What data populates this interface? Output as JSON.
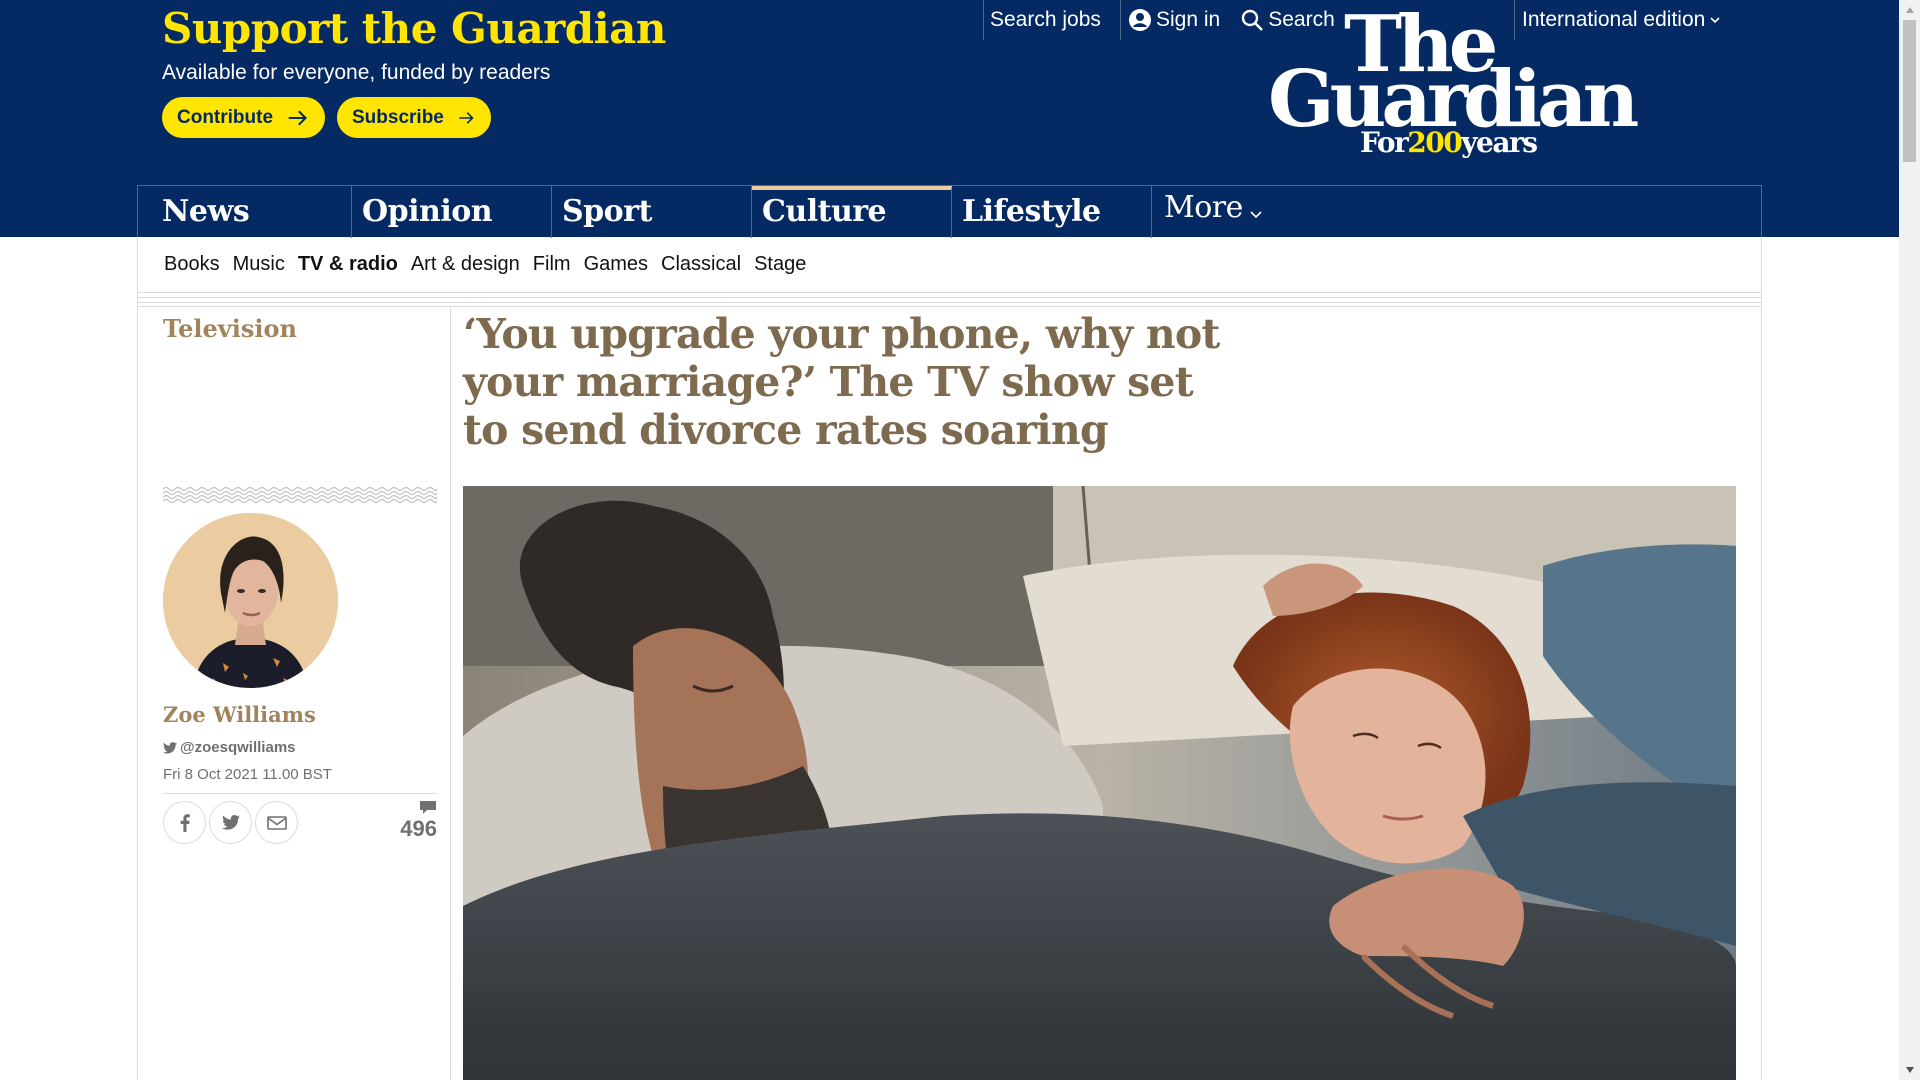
{
  "support": {
    "title": "Support the Guardian",
    "subtitle": "Available for everyone, funded by readers",
    "contribute_label": "Contribute",
    "subscribe_label": "Subscribe"
  },
  "top_links": {
    "search_jobs": "Search jobs",
    "sign_in": "Sign in",
    "search": "Search",
    "edition": "International edition"
  },
  "logo": {
    "line1": "The",
    "line2": "Guardian",
    "tag_prefix": "For",
    "tag_number": "200",
    "tag_suffix": "years"
  },
  "pillars": [
    {
      "label": "News"
    },
    {
      "label": "Opinion"
    },
    {
      "label": "Sport"
    },
    {
      "label": "Culture"
    },
    {
      "label": "Lifestyle"
    },
    {
      "label": "More"
    }
  ],
  "active_pillar": "Culture",
  "subnav": [
    {
      "label": "Books"
    },
    {
      "label": "Music"
    },
    {
      "label": "TV & radio"
    },
    {
      "label": "Art & design"
    },
    {
      "label": "Film"
    },
    {
      "label": "Games"
    },
    {
      "label": "Classical"
    },
    {
      "label": "Stage"
    }
  ],
  "active_subnav": "TV & radio",
  "article": {
    "section": "Television",
    "headline": "‘You upgrade your phone, why not your marriage?’ The TV show set to send divorce rates soaring",
    "author": "Zoe Williams",
    "twitter": "@zoesqwilliams",
    "date": "Fri 8 Oct 2021 11.00 BST",
    "comment_count": "496"
  },
  "colors": {
    "brand_blue": "#052962",
    "brand_yellow": "#ffe500",
    "culture_accent": "#a1845c",
    "headline": "#7d6a4f",
    "culture_border": "#eacca0"
  },
  "icons": {
    "sign_in": "profile-icon",
    "search": "magnifier-icon",
    "edition": "chevron-down-icon",
    "share": [
      "facebook-icon",
      "twitter-icon",
      "email-icon"
    ],
    "comments": "comment-bubble-icon"
  }
}
